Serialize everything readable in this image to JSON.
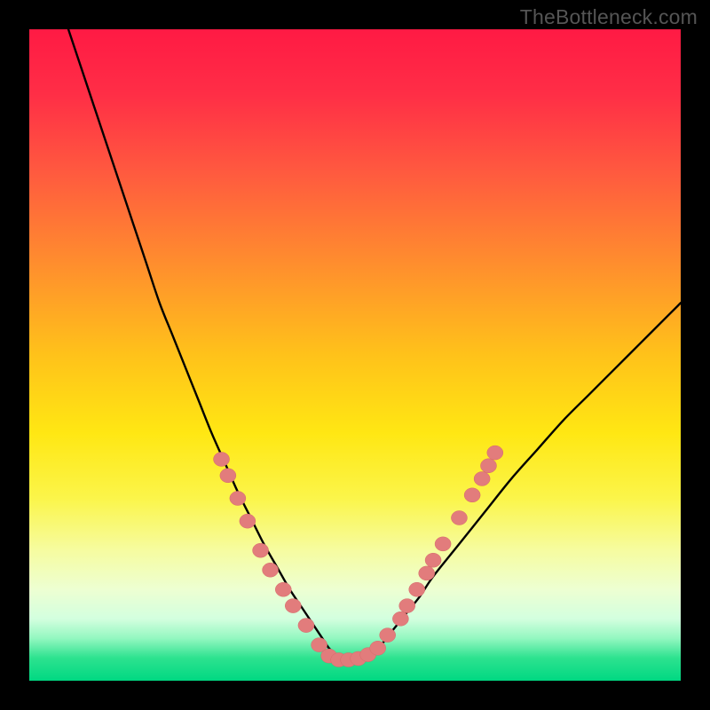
{
  "watermark": "TheBottleneck.com",
  "colors": {
    "gradient_stops": [
      {
        "offset": 0.0,
        "color": "#ff1a44"
      },
      {
        "offset": 0.1,
        "color": "#ff2e46"
      },
      {
        "offset": 0.22,
        "color": "#ff5a3f"
      },
      {
        "offset": 0.35,
        "color": "#ff8a2f"
      },
      {
        "offset": 0.5,
        "color": "#ffc21a"
      },
      {
        "offset": 0.62,
        "color": "#ffe713"
      },
      {
        "offset": 0.72,
        "color": "#fbf54a"
      },
      {
        "offset": 0.8,
        "color": "#f6fca0"
      },
      {
        "offset": 0.86,
        "color": "#edffd2"
      },
      {
        "offset": 0.905,
        "color": "#d3ffdf"
      },
      {
        "offset": 0.935,
        "color": "#93f7c0"
      },
      {
        "offset": 0.965,
        "color": "#2de28f"
      },
      {
        "offset": 1.0,
        "color": "#00d882"
      }
    ],
    "curve": "#000000",
    "dot_fill": "#e27c7c",
    "dot_stroke": "#d66a6a"
  },
  "chart_data": {
    "type": "line",
    "title": "",
    "xlabel": "",
    "ylabel": "",
    "xlim": [
      0,
      100
    ],
    "ylim": [
      0,
      100
    ],
    "series": [
      {
        "name": "bottleneck-curve",
        "x": [
          6,
          8,
          10,
          12,
          14,
          16,
          18,
          20,
          22,
          24,
          26,
          28,
          30,
          32,
          34,
          36,
          38,
          40,
          42,
          44,
          45,
          46,
          47,
          48,
          49,
          50,
          51,
          52,
          54,
          56,
          58,
          60,
          62,
          66,
          70,
          74,
          78,
          82,
          86,
          90,
          94,
          98,
          100
        ],
        "y": [
          100,
          94,
          88,
          82,
          76,
          70,
          64,
          58,
          53,
          48,
          43,
          38,
          33.5,
          29,
          25,
          21,
          17.5,
          14,
          11,
          8,
          6.5,
          5,
          4,
          3.2,
          3,
          3,
          3.2,
          3.8,
          5.5,
          8,
          10.5,
          13,
          16,
          21,
          26,
          31,
          35.5,
          40,
          44,
          48,
          52,
          56,
          58
        ]
      }
    ],
    "markers": {
      "name": "zone-dots",
      "points": [
        {
          "x": 29.5,
          "y": 34
        },
        {
          "x": 30.5,
          "y": 31.5
        },
        {
          "x": 32.0,
          "y": 28
        },
        {
          "x": 33.5,
          "y": 24.5
        },
        {
          "x": 35.5,
          "y": 20
        },
        {
          "x": 37.0,
          "y": 17
        },
        {
          "x": 39.0,
          "y": 14
        },
        {
          "x": 40.5,
          "y": 11.5
        },
        {
          "x": 42.5,
          "y": 8.5
        },
        {
          "x": 44.5,
          "y": 5.5
        },
        {
          "x": 46.0,
          "y": 3.8
        },
        {
          "x": 47.5,
          "y": 3.2
        },
        {
          "x": 49.0,
          "y": 3.2
        },
        {
          "x": 50.5,
          "y": 3.4
        },
        {
          "x": 52.0,
          "y": 4.0
        },
        {
          "x": 53.5,
          "y": 5.0
        },
        {
          "x": 55.0,
          "y": 7.0
        },
        {
          "x": 57.0,
          "y": 9.5
        },
        {
          "x": 58.0,
          "y": 11.5
        },
        {
          "x": 59.5,
          "y": 14
        },
        {
          "x": 61.0,
          "y": 16.5
        },
        {
          "x": 62.0,
          "y": 18.5
        },
        {
          "x": 63.5,
          "y": 21
        },
        {
          "x": 66.0,
          "y": 25
        },
        {
          "x": 68.0,
          "y": 28.5
        },
        {
          "x": 69.5,
          "y": 31
        },
        {
          "x": 70.5,
          "y": 33
        },
        {
          "x": 71.5,
          "y": 35
        }
      ]
    }
  }
}
